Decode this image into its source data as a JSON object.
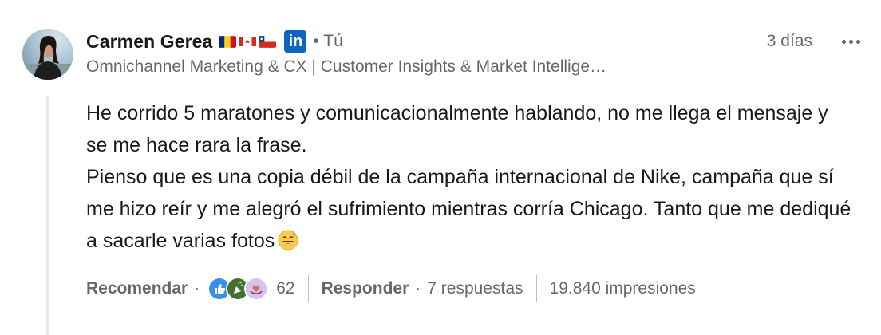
{
  "comment": {
    "author": {
      "name": "Carmen Gerea",
      "flags": [
        "romania-flag",
        "canada-flag",
        "chile-flag"
      ],
      "badge": "in",
      "you_label": "• Tú",
      "headline": "Omnichannel Marketing & CX | Customer Insights & Market Intellige…"
    },
    "time": "3 días",
    "text_lines": [
      "He corrido 5 maratones y comunicacionalmente hablando, no me llega el mensaje y se me hace rara la frase.",
      "Pienso que es una copia débil de la campaña internacional de Nike, campaña que sí me hizo reír y me alegró el sufrimiento mientras corría Chicago. Tanto que me dediqué a sacarle varias fotos"
    ],
    "actions": {
      "like": "Recomendar",
      "separator": "·",
      "reaction_count": "62",
      "reply": "Responder",
      "replies": "7 respuestas",
      "impressions": "19.840 impresiones"
    },
    "reaction_icons": [
      "like-icon",
      "celebrate-icon",
      "support-icon"
    ]
  },
  "colors": {
    "linkedin_blue": "#0a66c2",
    "text_primary": "rgba(0,0,0,0.9)",
    "text_secondary": "rgba(0,0,0,0.6)"
  }
}
